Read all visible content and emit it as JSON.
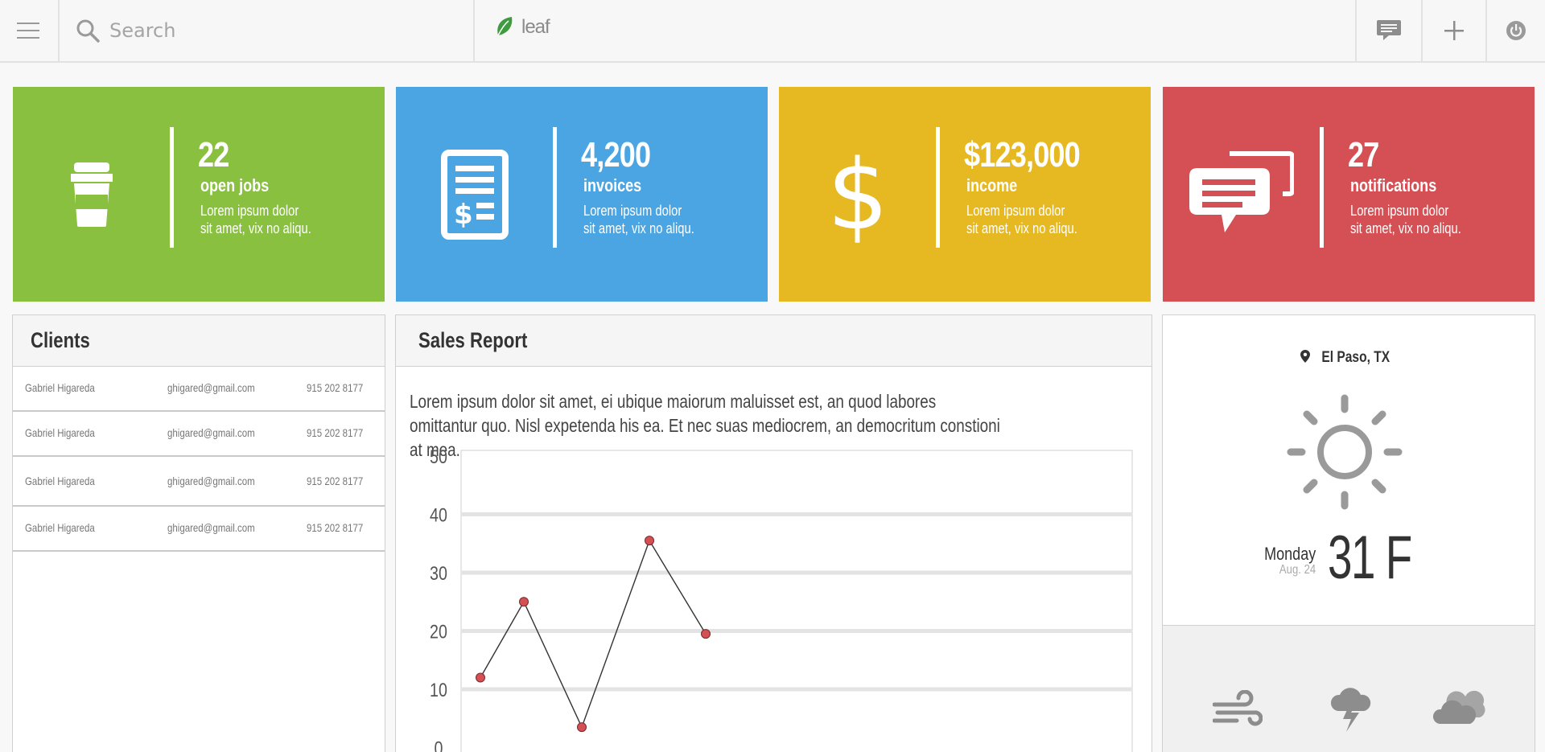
{
  "topbar": {
    "search_placeholder": "Search",
    "brand": "leaf",
    "brand_color": "#3f9b3f"
  },
  "cards": [
    {
      "value": "22",
      "label": "open jobs",
      "desc": "Lorem ipsum dolor sit amet, vix no aliqu.",
      "color": "#89c03f",
      "icon": "coffee-cup-icon"
    },
    {
      "value": "4,200",
      "label": "invoices",
      "desc": "Lorem ipsum dolor sit amet, vix no aliqu.",
      "color": "#4ba5e2",
      "icon": "invoice-icon"
    },
    {
      "value": "$123,000",
      "label": "income",
      "desc": "Lorem ipsum dolor sit amet, vix no aliqu.",
      "color": "#e6b821",
      "icon": "dollar-icon"
    },
    {
      "value": "27",
      "label": "notifications",
      "desc": "Lorem ipsum dolor sit amet, vix no aliqu.",
      "color": "#d45055",
      "icon": "chat-bubbles-icon"
    }
  ],
  "clients": {
    "title": "Clients",
    "rows": [
      {
        "name": "Gabriel Higareda",
        "email": "ghigared@gmail.com",
        "phone": "915 202 8177"
      },
      {
        "name": "Gabriel Higareda",
        "email": "ghigared@gmail.com",
        "phone": "915 202 8177"
      },
      {
        "name": "Gabriel Higareda",
        "email": "ghigared@gmail.com",
        "phone": "915 202 8177"
      },
      {
        "name": "Gabriel Higareda",
        "email": "ghigared@gmail.com",
        "phone": "915 202 8177"
      }
    ]
  },
  "sales": {
    "title": "Sales Report",
    "text": "Lorem ipsum dolor sit amet, ei ubique maiorum maluisset est, an quod labores omittantur quo. Nisl expetenda his ea. Et nec suas mediocrem, an democritum constioni at mea."
  },
  "chart_data": {
    "type": "line",
    "x": [
      1,
      2,
      3,
      4,
      5
    ],
    "series": [
      {
        "values": [
          12,
          25,
          3.5,
          35.5,
          19.5
        ],
        "color": "#d45055"
      }
    ],
    "yticks": [
      0,
      10,
      20,
      30,
      40,
      50
    ],
    "ylim": [
      0,
      50
    ],
    "grid": true
  },
  "weather": {
    "location": "El Paso, TX",
    "day": "Monday",
    "date": "Aug. 24",
    "temp": "31 F",
    "icons": [
      "wind-icon",
      "storm-cloud-icon",
      "cloudy-icon"
    ]
  }
}
